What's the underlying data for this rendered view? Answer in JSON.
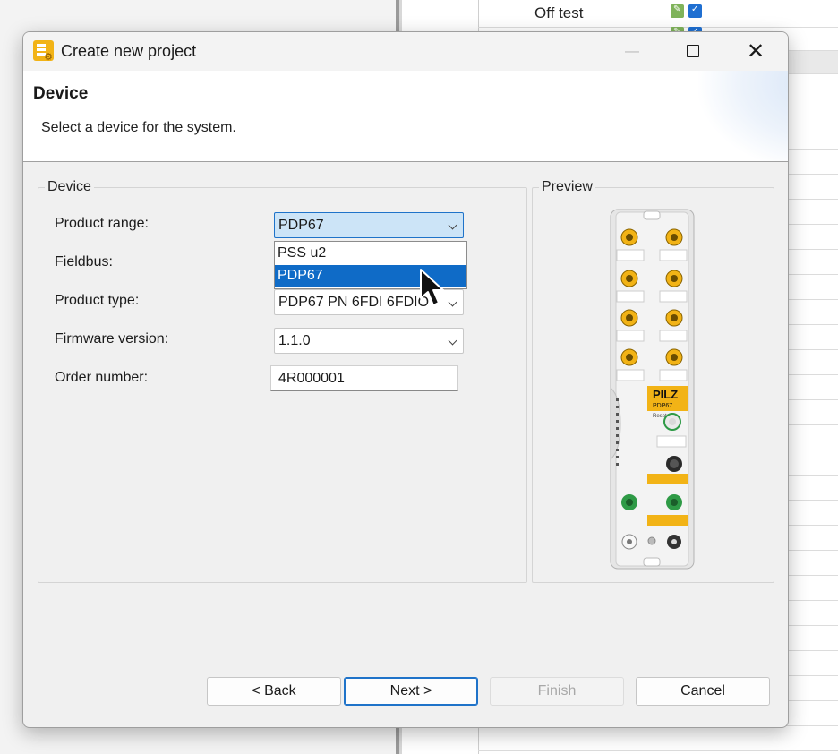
{
  "background_app": {
    "row_text": "Off test"
  },
  "dialog": {
    "title": "Create new project",
    "header": {
      "title": "Device",
      "subtitle": "Select a device for the system."
    },
    "device_group": {
      "title": "Device",
      "fields": {
        "product_range": {
          "label": "Product range:",
          "value": "PDP67"
        },
        "fieldbus": {
          "label": "Fieldbus:"
        },
        "product_type": {
          "label": "Product type:",
          "value": "PDP67 PN 6FDI 6FDIO"
        },
        "firmware_version": {
          "label": "Firmware version:",
          "value": "1.1.0"
        },
        "order_number": {
          "label": "Order number:",
          "value": "4R000001"
        }
      },
      "dropdown_options": [
        {
          "label": "PSS u2",
          "selected": false
        },
        {
          "label": "PDP67",
          "selected": true
        }
      ]
    },
    "preview_group": {
      "title": "Preview",
      "device_image": {
        "brand": "PILZ",
        "model": "PDP67",
        "reset_label": "Reset",
        "ports": [
          "X01",
          "X02",
          "X03",
          "X04",
          "X05",
          "X06",
          "X07",
          "X08",
          "X20",
          "X21",
          "X22",
          "X31",
          "X32"
        ],
        "leds": [
          "MS",
          "PWR",
          "SD",
          "X21",
          "X22",
          "RUN",
          "DIAG",
          "S0"
        ]
      }
    },
    "buttons": {
      "back": "< Back",
      "next": "Next >",
      "finish": "Finish",
      "cancel": "Cancel"
    }
  },
  "colors": {
    "accent": "#0f6bc7",
    "combo_active": "#cce4f7",
    "pilz_yellow": "#f2b316"
  }
}
